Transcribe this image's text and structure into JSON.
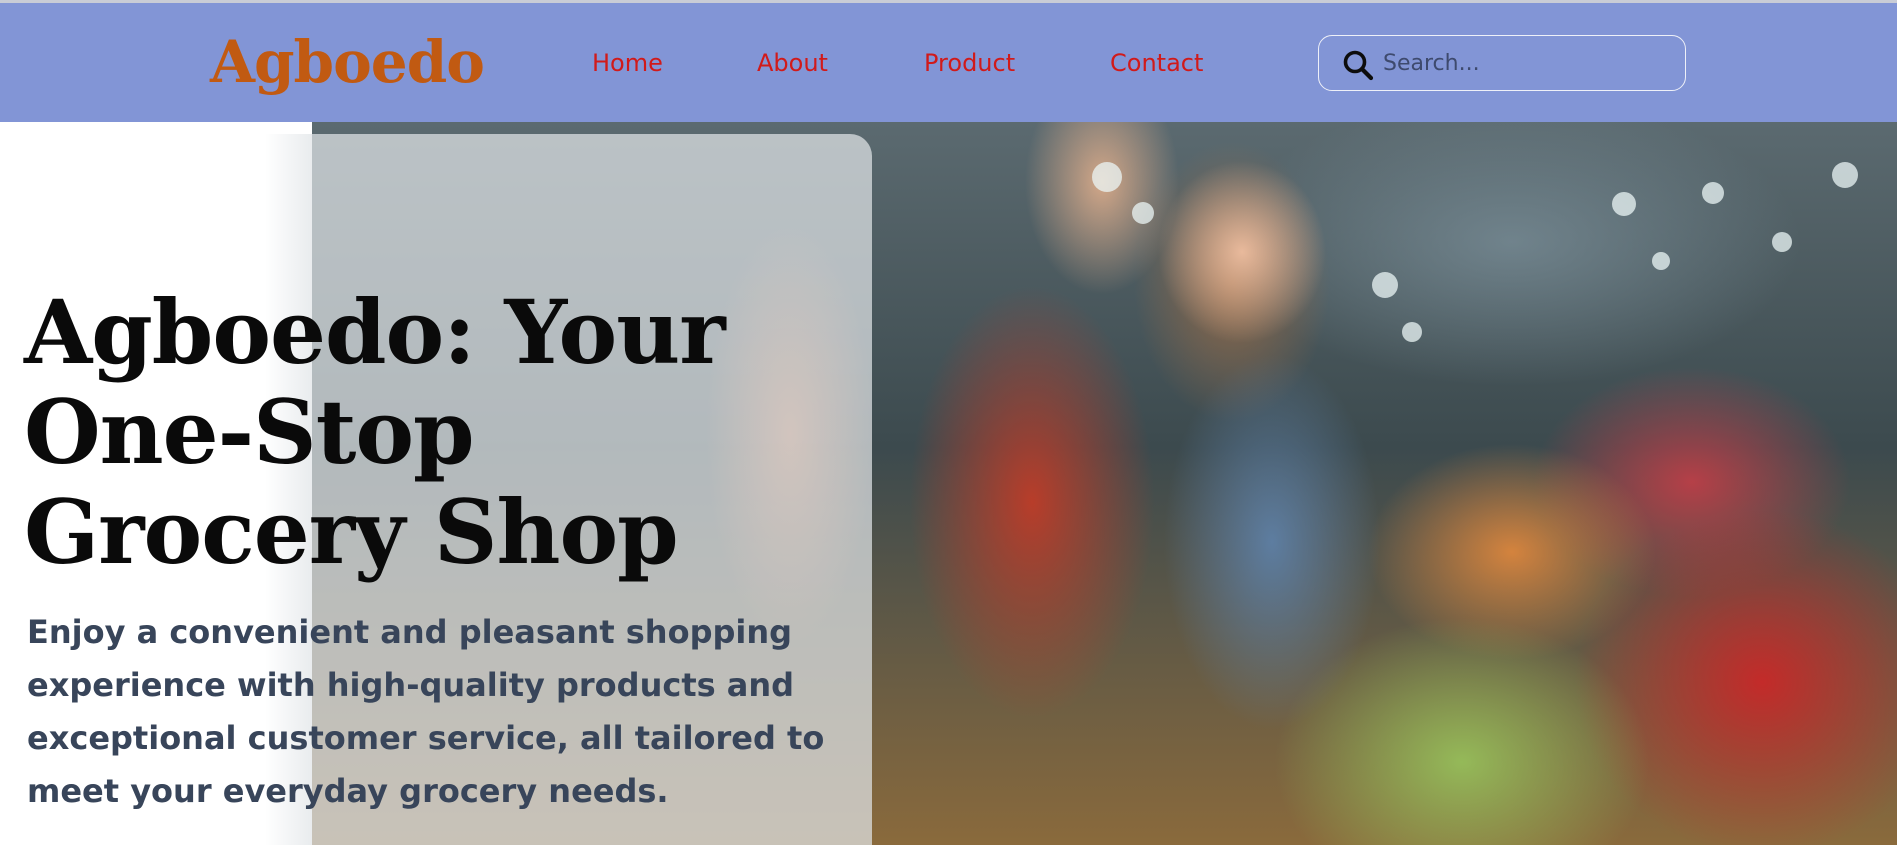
{
  "brand": {
    "logo_text": "Agboedo",
    "logo_color": "#c15a12"
  },
  "nav": {
    "background_color": "#8295d6",
    "link_color": "#d11a1a",
    "items": [
      {
        "label": "Home"
      },
      {
        "label": "About"
      },
      {
        "label": "Product"
      },
      {
        "label": "Contact"
      }
    ]
  },
  "search": {
    "icon": "search-icon",
    "placeholder": "Search...",
    "value": ""
  },
  "hero": {
    "title": "Agboedo: Your One-Stop Grocery Shop",
    "description": "Enjoy a convenient and pleasant shopping experience with high-quality products and exceptional customer service, all tailored to meet your everyday grocery needs."
  }
}
